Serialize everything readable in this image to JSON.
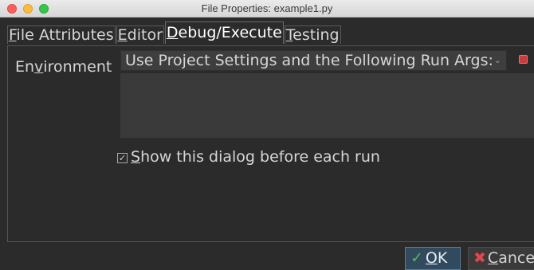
{
  "window": {
    "title": "File Properties: example1.py"
  },
  "tabs": [
    {
      "pre": "",
      "u": "F",
      "post": "ile Attributes"
    },
    {
      "pre": "",
      "u": "E",
      "post": "ditor"
    },
    {
      "pre": "",
      "u": "D",
      "post": "ebug/Execute"
    },
    {
      "pre": "",
      "u": "T",
      "post": "esting"
    }
  ],
  "active_tab": "Debug/Execute",
  "environment": {
    "label_pre": "En",
    "label_u": "v",
    "label_post": "ironment",
    "selected": "Use Project Settings and the Following Run Args:",
    "arrow": "⌄"
  },
  "show_dialog": {
    "checked": true,
    "check_glyph": "✓",
    "label_u": "S",
    "label_post": "how this dialog before each run"
  },
  "buttons": {
    "ok": {
      "mark": "✓",
      "u": "O",
      "post": "K"
    },
    "cancel": {
      "mark": "✖",
      "u": "C",
      "post": "ancel"
    }
  },
  "colors": {
    "ok_check": "#52b85a",
    "cancel_x": "#e0484a",
    "side_checkbox": "#cc3b3b"
  }
}
